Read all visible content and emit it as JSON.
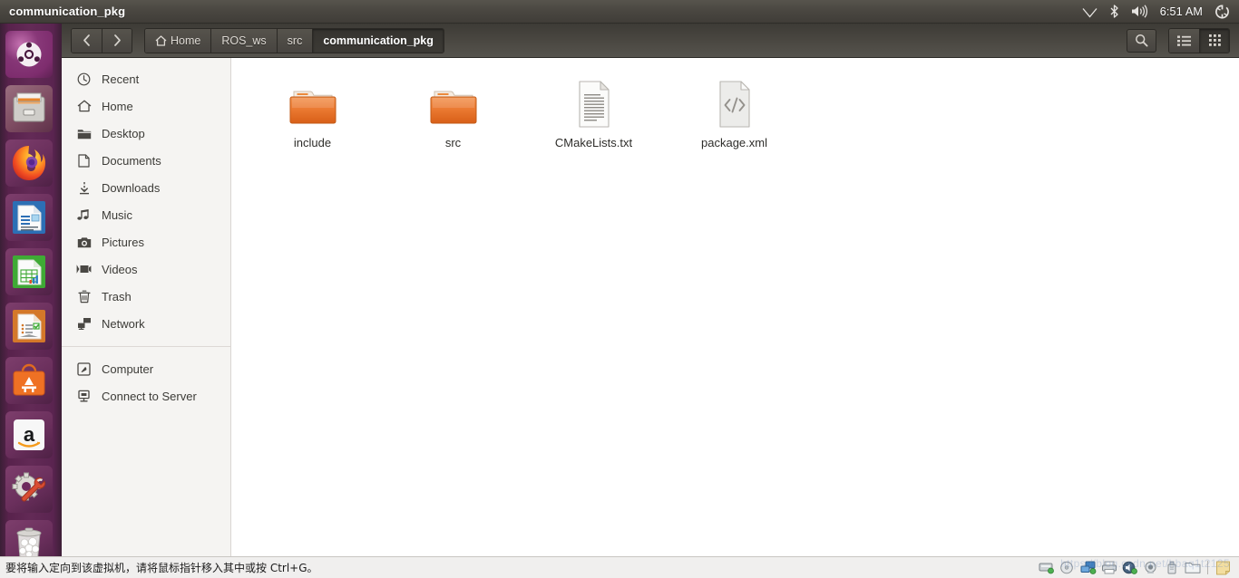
{
  "panel": {
    "title": "communication_pkg",
    "clock": "6:51 AM",
    "indicators": [
      {
        "name": "network-icon",
        "label": "network"
      },
      {
        "name": "bluetooth-icon",
        "label": "bluetooth"
      },
      {
        "name": "volume-icon",
        "label": "volume"
      },
      {
        "name": "system-menu-icon",
        "label": "system menu"
      }
    ]
  },
  "launcher": {
    "items": [
      {
        "name": "dash-ubuntu-button",
        "label": "Ubuntu Dash",
        "icon": "ubuntu-logo-icon",
        "running": false
      },
      {
        "name": "files-launcher-item",
        "label": "Files",
        "icon": "file-cabinet-icon",
        "running": true
      },
      {
        "name": "firefox-launcher-item",
        "label": "Firefox",
        "icon": "firefox-icon",
        "running": false
      },
      {
        "name": "libreoffice-writer-launcher-item",
        "label": "LibreOffice Writer",
        "icon": "writer-document-icon",
        "running": false
      },
      {
        "name": "libreoffice-calc-launcher-item",
        "label": "LibreOffice Calc",
        "icon": "calc-spreadsheet-icon",
        "running": false
      },
      {
        "name": "libreoffice-impress-launcher-item",
        "label": "LibreOffice Impress",
        "icon": "impress-presentation-icon",
        "running": false
      },
      {
        "name": "ubuntu-software-launcher-item",
        "label": "Ubuntu Software",
        "icon": "software-bag-icon",
        "running": false
      },
      {
        "name": "amazon-launcher-item",
        "label": "Amazon",
        "icon": "amazon-icon",
        "running": false
      },
      {
        "name": "system-settings-launcher-item",
        "label": "System Settings",
        "icon": "gear-wrench-icon",
        "running": false
      },
      {
        "name": "trash-launcher-item",
        "label": "Trash",
        "icon": "trash-bin-icon",
        "running": true
      }
    ]
  },
  "toolbar": {
    "back_label": "‹",
    "forward_label": "›",
    "breadcrumbs": [
      {
        "label": "Home",
        "icon": "home-icon",
        "active": false
      },
      {
        "label": "ROS_ws",
        "icon": "",
        "active": false
      },
      {
        "label": "src",
        "icon": "",
        "active": false
      },
      {
        "label": "communication_pkg",
        "icon": "",
        "active": true
      }
    ],
    "search_label": "Search",
    "list_view_label": "List view",
    "grid_view_label": "Icon view",
    "active_view": "grid"
  },
  "sidebar": {
    "items": [
      {
        "label": "Recent",
        "icon": "clock-icon"
      },
      {
        "label": "Home",
        "icon": "home-icon"
      },
      {
        "label": "Desktop",
        "icon": "folder-icon"
      },
      {
        "label": "Documents",
        "icon": "document-icon"
      },
      {
        "label": "Downloads",
        "icon": "download-arrow-icon"
      },
      {
        "label": "Music",
        "icon": "music-note-icon"
      },
      {
        "label": "Pictures",
        "icon": "camera-icon"
      },
      {
        "label": "Videos",
        "icon": "video-camera-icon"
      },
      {
        "label": "Trash",
        "icon": "trash-icon"
      },
      {
        "label": "Network",
        "icon": "network-icon"
      }
    ],
    "devices": [
      {
        "label": "Computer",
        "icon": "computer-disk-icon"
      },
      {
        "label": "Connect to Server",
        "icon": "server-icon"
      }
    ]
  },
  "files": [
    {
      "name": "include",
      "type": "folder",
      "icon": "folder-icon"
    },
    {
      "name": "src",
      "type": "folder",
      "icon": "folder-icon"
    },
    {
      "name": "CMakeLists.txt",
      "type": "text",
      "icon": "text-document-icon"
    },
    {
      "name": "package.xml",
      "type": "code",
      "icon": "code-document-icon"
    }
  ],
  "vmware": {
    "message": "要将输入定向到该虚拟机，请将鼠标指针移入其中或按 Ctrl+G。",
    "watermark": "https://blog.csdn.net/hbaq1t2125",
    "devices": [
      {
        "name": "harddisk-status-icon",
        "label": "Hard Disk"
      },
      {
        "name": "cd-dvd-status-icon",
        "label": "CD/DVD"
      },
      {
        "name": "network-adapter-status-icon",
        "label": "Network Adapter"
      },
      {
        "name": "printer-status-icon",
        "label": "Printer"
      },
      {
        "name": "sound-card-status-icon",
        "label": "Sound Card"
      },
      {
        "name": "camera-status-icon",
        "label": "Camera"
      },
      {
        "name": "usb-status-icon",
        "label": "USB"
      },
      {
        "name": "shared-folders-status-icon",
        "label": "Shared Folders"
      },
      {
        "name": "notes-status-icon",
        "label": "Notes"
      }
    ]
  },
  "colors": {
    "panel": "#4a4741",
    "launcher": "#632a56",
    "header": "#4b4842",
    "sidebar": "#f5f4f2",
    "folder": "#e8762b",
    "content": "#ffffff"
  }
}
